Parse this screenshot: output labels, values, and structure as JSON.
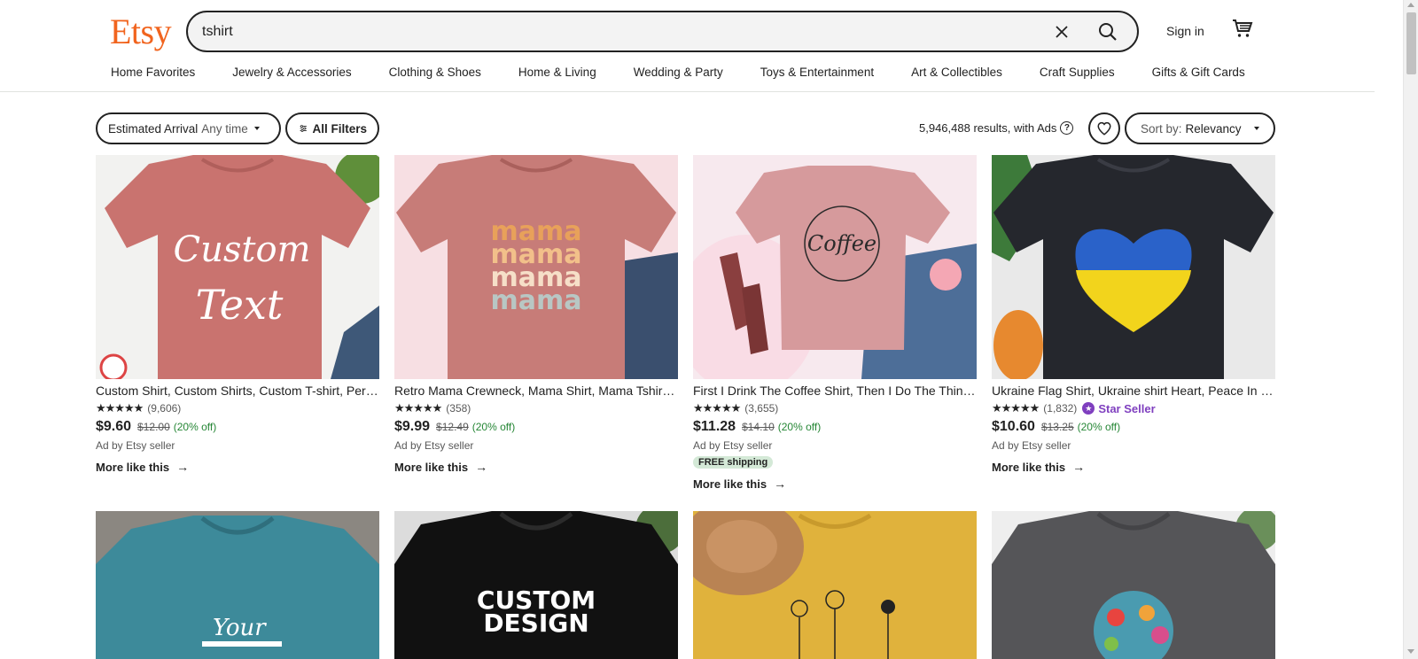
{
  "header": {
    "logo": "Etsy",
    "search_value": "tshirt",
    "sign_in": "Sign in",
    "categories": [
      "Home Favorites",
      "Jewelry & Accessories",
      "Clothing & Shoes",
      "Home & Living",
      "Wedding & Party",
      "Toys & Entertainment",
      "Art & Collectibles",
      "Craft Supplies",
      "Gifts & Gift Cards"
    ]
  },
  "filters": {
    "arrival_label": "Estimated Arrival",
    "arrival_value": "Any time",
    "all_filters": "All Filters",
    "results_text": "5,946,488 results, with Ads",
    "sort_label": "Sort by:",
    "sort_value": "Relevancy"
  },
  "products": [
    {
      "title": "Custom Shirt, Custom Shirts, Custom T-shirt, Personalized T-shirt",
      "stars": "★★★★★",
      "reviews": "(9,606)",
      "price": "$9.60",
      "original_price": "$12.00",
      "discount": "(20% off)",
      "ad": "Ad by Etsy seller",
      "more": "More like this",
      "image_text": "Custom Text",
      "shirt_color": "#c9736f"
    },
    {
      "title": "Retro Mama Crewneck, Mama Shirt, Mama Tshirt, Mom Shirt",
      "stars": "★★★★★",
      "reviews": "(358)",
      "price": "$9.99",
      "original_price": "$12.49",
      "discount": "(20% off)",
      "ad": "Ad by Etsy seller",
      "more": "More like this",
      "image_text": "mama",
      "shirt_color": "#c77c78"
    },
    {
      "title": "First I Drink The Coffee Shirt, Then I Do The Things Shirt",
      "stars": "★★★★★",
      "reviews": "(3,655)",
      "price": "$11.28",
      "original_price": "$14.10",
      "discount": "(20% off)",
      "ad": "Ad by Etsy seller",
      "shipping": "FREE shipping",
      "more": "More like this",
      "image_text": "Coffee",
      "shirt_color": "#d69a9c"
    },
    {
      "title": "Ukraine Flag Shirt, Ukraine shirt Heart, Peace In Ukraine",
      "stars": "★★★★★",
      "reviews": "(1,832)",
      "star_seller": "Star Seller",
      "price": "$10.60",
      "original_price": "$13.25",
      "discount": "(20% off)",
      "ad": "Ad by Etsy seller",
      "more": "More like this",
      "shirt_color": "#25272d"
    }
  ],
  "second_row": [
    {
      "shirt_color": "#3d8a9a",
      "image_text": "Your TEXT"
    },
    {
      "shirt_color": "#111111",
      "image_text": "CUSTOM DESIGN"
    },
    {
      "shirt_color": "#e0b23c",
      "image_text": ""
    },
    {
      "shirt_color": "#555558",
      "image_text": ""
    }
  ]
}
